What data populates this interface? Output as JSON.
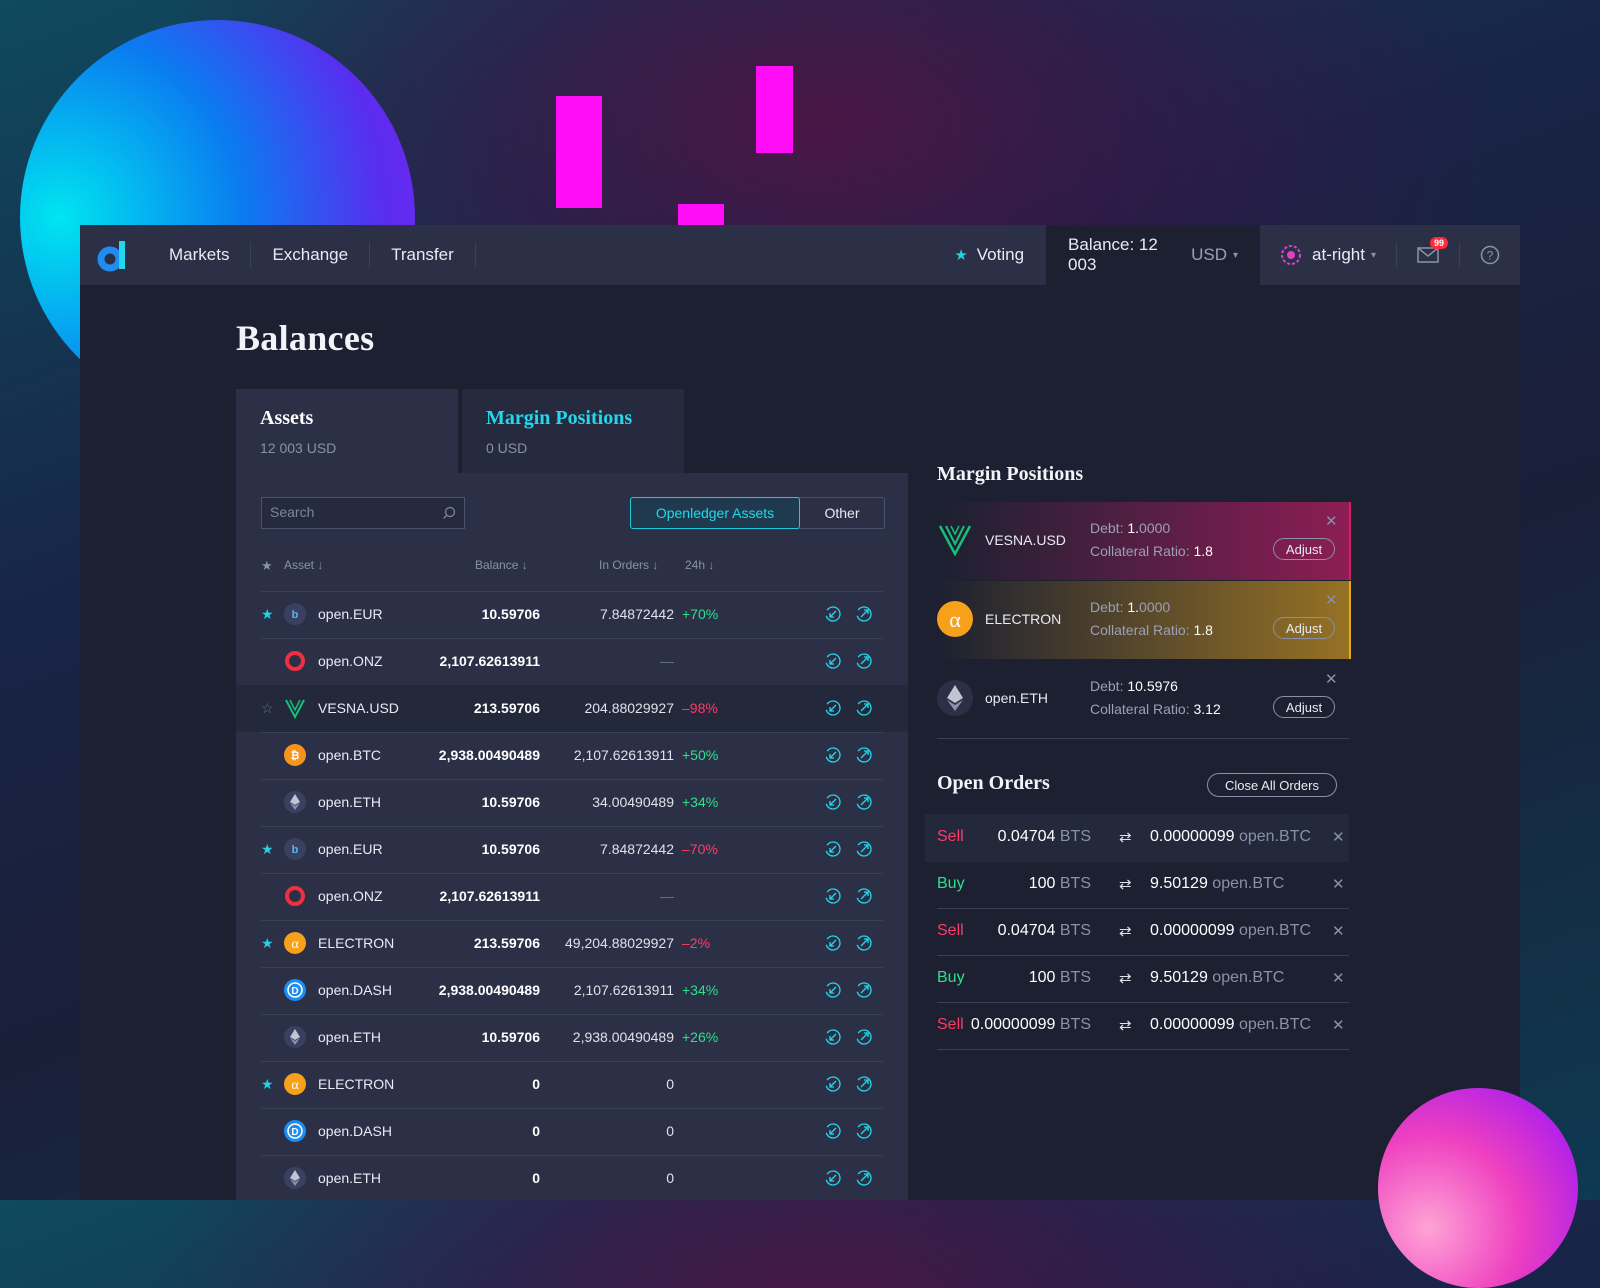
{
  "nav": {
    "items": [
      "Markets",
      "Exchange",
      "Transfer"
    ],
    "voting": "Voting",
    "balance_label": "Balance: 12 003",
    "balance_unit": "USD",
    "account": "at-right",
    "mail_count": "99"
  },
  "page": {
    "title": "Balances"
  },
  "tabs": {
    "assets": {
      "label": "Assets",
      "value": "12 003 USD"
    },
    "margin": {
      "label": "Margin Positions",
      "value": "0 USD"
    }
  },
  "filters": {
    "search_placeholder": "Search",
    "openledger": "Openledger Assets",
    "other": "Other"
  },
  "table": {
    "headers": {
      "asset": "Asset",
      "balance": "Balance",
      "in_orders": "In Orders",
      "change": "24h"
    },
    "rows": [
      {
        "star": "filled",
        "icon": "bitshares-icon",
        "name": "open.EUR",
        "balance": "10.59706",
        "orders": "7.84872442",
        "change": "+70%",
        "dir": "pos"
      },
      {
        "star": "none",
        "icon": "onz-icon",
        "name": "open.ONZ",
        "balance": "2,107.62613911",
        "orders": "—",
        "change": "",
        "dir": ""
      },
      {
        "star": "empty",
        "icon": "vesna-icon",
        "name": "VESNA.USD",
        "balance": "213.59706",
        "orders": "204.88029927",
        "change": "–98%",
        "dir": "neg"
      },
      {
        "star": "none",
        "icon": "bitcoin-icon",
        "name": "open.BTC",
        "balance": "2,938.00490489",
        "orders": "2,107.62613911",
        "change": "+50%",
        "dir": "pos"
      },
      {
        "star": "none",
        "icon": "ethereum-icon",
        "name": "open.ETH",
        "balance": "10.59706",
        "orders": "34.00490489",
        "change": "+34%",
        "dir": "pos"
      },
      {
        "star": "filled",
        "icon": "bitshares-icon",
        "name": "open.EUR",
        "balance": "10.59706",
        "orders": "7.84872442",
        "change": "–70%",
        "dir": "neg"
      },
      {
        "star": "none",
        "icon": "onz-icon",
        "name": "open.ONZ",
        "balance": "2,107.62613911",
        "orders": "—",
        "change": "",
        "dir": ""
      },
      {
        "star": "filled",
        "icon": "electron-icon",
        "name": "ELECTRON",
        "balance": "213.59706",
        "orders": "49,204.88029927",
        "change": "–2%",
        "dir": "neg"
      },
      {
        "star": "none",
        "icon": "dash-icon",
        "name": "open.DASH",
        "balance": "2,938.00490489",
        "orders": "2,107.62613911",
        "change": "+34%",
        "dir": "pos"
      },
      {
        "star": "none",
        "icon": "ethereum-icon",
        "name": "open.ETH",
        "balance": "10.59706",
        "orders": "2,938.00490489",
        "change": "+26%",
        "dir": "pos"
      },
      {
        "star": "filled",
        "icon": "electron-icon",
        "name": "ELECTRON",
        "balance": "0",
        "orders": "0",
        "change": "",
        "dir": ""
      },
      {
        "star": "none",
        "icon": "dash-icon",
        "name": "open.DASH",
        "balance": "0",
        "orders": "0",
        "change": "",
        "dir": ""
      },
      {
        "star": "none",
        "icon": "ethereum-icon",
        "name": "open.ETH",
        "balance": "0",
        "orders": "0",
        "change": "",
        "dir": ""
      }
    ]
  },
  "margin_positions": {
    "title": "Margin Positions",
    "debt_label": "Debt:",
    "ratio_label": "Collateral Ratio:",
    "adjust_label": "Adjust",
    "items": [
      {
        "name": "VESNA.USD",
        "debt_main": "1.",
        "debt_rest": "0000",
        "ratio": "1.8",
        "accent": "#d81c6c"
      },
      {
        "name": "ELECTRON",
        "debt_main": "1.",
        "debt_rest": "0000",
        "ratio": "1.8",
        "accent": "#e8a81c"
      },
      {
        "name": "open.ETH",
        "debt_main": "10.5976",
        "debt_rest": "",
        "ratio": "3.12",
        "accent": ""
      }
    ]
  },
  "open_orders": {
    "title": "Open Orders",
    "close_all": "Close All Orders",
    "items": [
      {
        "side": "Sell",
        "amount": "0.04704",
        "amount_unit": "BTS",
        "total": "0.00000099",
        "total_unit": "open.BTC"
      },
      {
        "side": "Buy",
        "amount": "100",
        "amount_unit": "BTS",
        "total": "9.50129",
        "total_unit": "open.BTC"
      },
      {
        "side": "Sell",
        "amount": "0.04704",
        "amount_unit": "BTS",
        "total": "0.00000099",
        "total_unit": "open.BTC"
      },
      {
        "side": "Buy",
        "amount": "100",
        "amount_unit": "BTS",
        "total": "9.50129",
        "total_unit": "open.BTC"
      },
      {
        "side": "Sell",
        "amount": "0.00000099",
        "amount_unit": "BTS",
        "total": "0.00000099",
        "total_unit": "open.BTC"
      }
    ]
  },
  "colors": {
    "accent": "#22d8ec",
    "positive": "#2ee08c",
    "negative": "#ff3b66",
    "sell": "#ff3b66",
    "buy": "#2ee08c"
  }
}
